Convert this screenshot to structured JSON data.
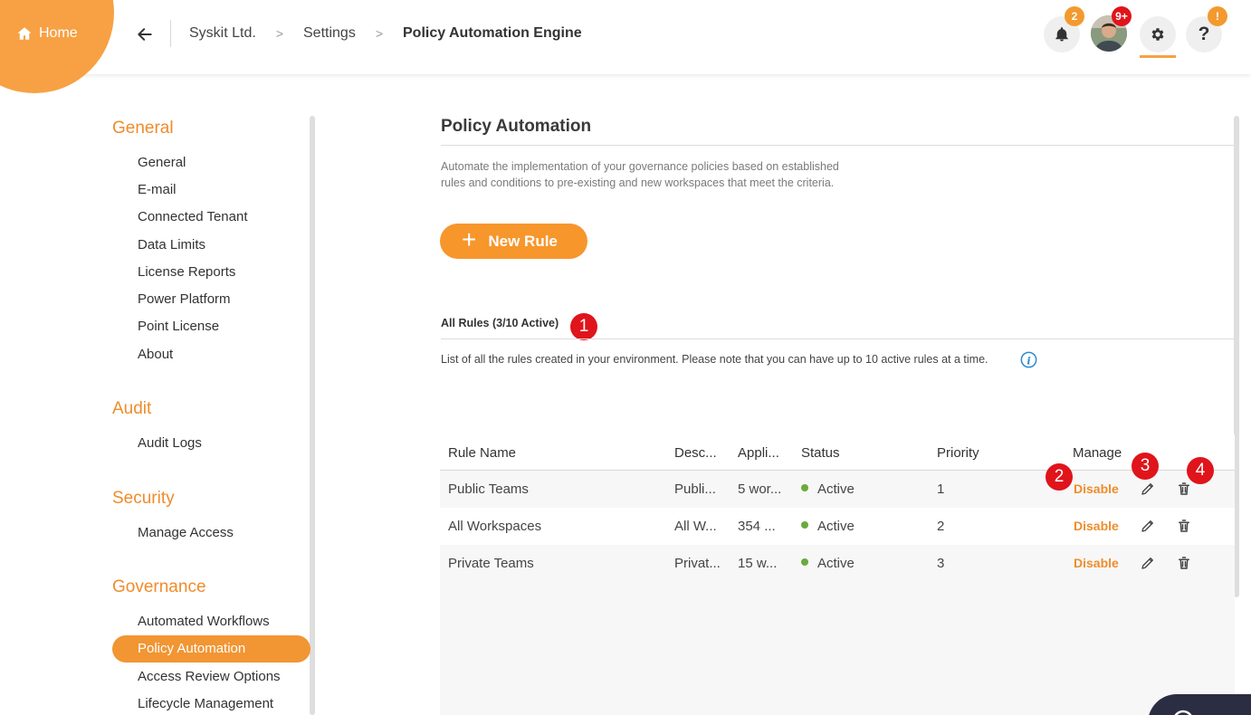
{
  "header": {
    "home_label": "Home",
    "breadcrumb": [
      "Syskit Ltd.",
      "Settings"
    ],
    "breadcrumb_current": "Policy Automation Engine",
    "notification_count": "2",
    "avatar_badge": "9+",
    "help_badge": "!",
    "accent_color": "#f7a144"
  },
  "sidebar": {
    "sections": [
      {
        "title": "General",
        "items": [
          "General",
          "E-mail",
          "Connected Tenant",
          "Data Limits",
          "License Reports",
          "Power Platform",
          "Point License",
          "About"
        ]
      },
      {
        "title": "Audit",
        "items": [
          "Audit Logs"
        ]
      },
      {
        "title": "Security",
        "items": [
          "Manage Access"
        ]
      },
      {
        "title": "Governance",
        "items": [
          "Automated Workflows",
          "Policy Automation",
          "Access Review Options",
          "Lifecycle Management"
        ]
      }
    ],
    "active_item": "Policy Automation"
  },
  "main": {
    "title": "Policy Automation",
    "description": "Automate the implementation of your governance policies based on established rules and conditions to pre-existing and new workspaces that meet the criteria.",
    "new_rule_label": "New Rule",
    "rules_title": "All Rules (3/10 Active)",
    "rules_description": "List of all the rules created in your environment. Please note that you can have up to 10 active rules at a time.",
    "table": {
      "columns": [
        "Rule Name",
        "Desc...",
        "Appli...",
        "Status",
        "Priority",
        "Manage"
      ],
      "rows": [
        {
          "name": "Public Teams",
          "desc": "Publi...",
          "applies": "5 wor...",
          "status": "Active",
          "priority": "1",
          "action": "Disable"
        },
        {
          "name": "All Workspaces",
          "desc": "All W...",
          "applies": "354 ...",
          "status": "Active",
          "priority": "2",
          "action": "Disable"
        },
        {
          "name": "Private Teams",
          "desc": "Privat...",
          "applies": "15 w...",
          "status": "Active",
          "priority": "3",
          "action": "Disable"
        }
      ]
    }
  },
  "markers": [
    "1",
    "2",
    "3",
    "4"
  ],
  "icons": {
    "home": "home-icon",
    "back": "arrow-left-icon",
    "bell": "bell-icon",
    "gear": "gear-icon",
    "help": "question-icon",
    "info": "info-icon",
    "edit": "pencil-icon",
    "delete": "trash-icon"
  }
}
